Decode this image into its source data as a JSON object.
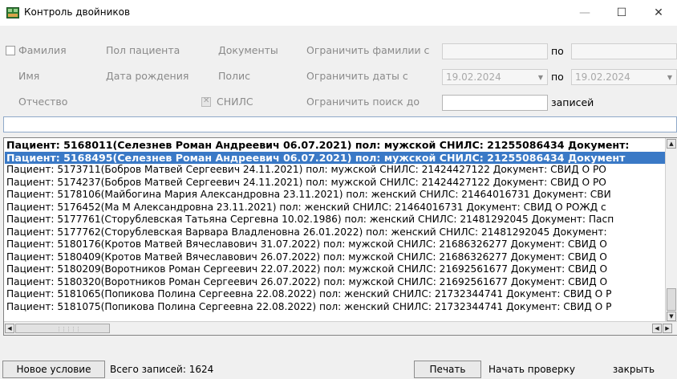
{
  "window": {
    "title": "Контроль двойников",
    "controls": {
      "minimize": "—",
      "maximize": "☐",
      "close": "✕"
    }
  },
  "filters": {
    "surname_label": "Фамилия",
    "name_label": "Имя",
    "patronymic_label": "Отчество",
    "gender_label": "Пол пациента",
    "birthdate_label": "Дата рождения",
    "documents_label": "Документы",
    "policy_label": "Полис",
    "snils_label": "СНИЛС",
    "limit_surnames_from_label": "Ограничить фамилии с",
    "limit_dates_from_label": "Ограничить даты с",
    "limit_search_to_label": "Ограничить поиск до",
    "surname_from_value": "",
    "surname_to_label": "по",
    "surname_to_value": "",
    "date_from_value": "19.02.2024",
    "date_to_label": "по",
    "date_to_value": "19.02.2024",
    "search_limit_value": "",
    "records_label": "записей"
  },
  "search": {
    "value": ""
  },
  "list": {
    "rows": [
      "Пациент: 5168011(Селезнев Роман Андреевич 06.07.2021) пол: мужской  СНИЛС: 21255086434  Документ:",
      "Пациент: 5168495(Селезнев Роман Андреевич 06.07.2021) пол: мужской  СНИЛС: 21255086434  Документ",
      "Пациент: 5173711(Бобров Матвей Сергеевич 24.11.2021) пол: мужской  СНИЛС: 21424427122  Документ: СВИД О РО",
      "Пациент: 5174237(Бобров Матвей Сергеевич 24.11.2021) пол: мужской  СНИЛС: 21424427122  Документ: СВИД О РО",
      "Пациент: 5178106(Майбогина Мария Александровна 23.11.2021) пол: женский  СНИЛС: 21464016731  Документ: СВИ",
      "Пациент: 5176452(Ма М Александровна 23.11.2021) пол: женский  СНИЛС: 21464016731  Документ: СВИД О РОЖД с",
      "Пациент: 5177761(Сторублевская Татьяна Сергевна 10.02.1986) пол: женский  СНИЛС: 21481292045  Документ: Пасп",
      "Пациент: 5177762(Сторублевская Варвара Владленовна 26.01.2022) пол: женский  СНИЛС: 21481292045  Документ:",
      "Пациент: 5180176(Кротов Матвей Вячеславович 31.07.2022) пол: мужской  СНИЛС: 21686326277  Документ: СВИД О",
      "Пациент: 5180409(Кротов Матвей Вячеславович 26.07.2022) пол: мужской  СНИЛС: 21686326277  Документ: СВИД О",
      "Пациент: 5180209(Воротников Роман Сергеевич 22.07.2022) пол: мужской  СНИЛС: 21692561677  Документ: СВИД О",
      "Пациент: 5180320(Воротников Роман Сергеевич 26.07.2022) пол: мужской  СНИЛС: 21692561677  Документ: СВИД О",
      "Пациент: 5181065(Попикова Полина Сергеевна 22.08.2022) пол: женский  СНИЛС: 21732344741  Документ: СВИД О Р",
      "Пациент: 5181075(Попикова Полина Сергеевна 22.08.2022) пол: женский  СНИЛС: 21732344741  Документ: СВИД О Р"
    ],
    "selected_index": 1,
    "bold_rows": [
      0,
      1
    ]
  },
  "bottom": {
    "new_condition": "Новое условие",
    "total_records": "Всего записей: 1624",
    "print": "Печать",
    "start_check": "Начать проверку",
    "close": "закрыть"
  },
  "colors": {
    "selection": "#3a79c6",
    "title_icon": "#2e7d32"
  },
  "icons": {
    "app": "duplicates-app-icon"
  }
}
